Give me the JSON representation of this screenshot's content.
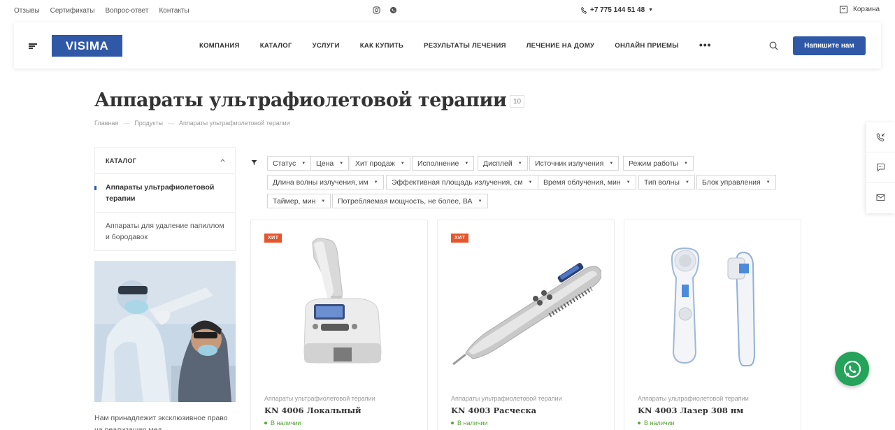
{
  "topbar": {
    "links": [
      "Отзывы",
      "Сертификаты",
      "Вопрос-ответ",
      "Контакты"
    ],
    "phone": "+7 775 144 51 48",
    "cart_label": "Корзина"
  },
  "header": {
    "logo": "VISIMA",
    "nav": [
      "КОМПАНИЯ",
      "КАТАЛОГ",
      "УСЛУГИ",
      "КАК КУПИТЬ",
      "РЕЗУЛЬТАТЫ ЛЕЧЕНИЯ",
      "ЛЕЧЕНИЕ НА ДОМУ",
      "ОНЛАЙН ПРИЕМЫ"
    ],
    "more": "•••",
    "cta": "Напишите нам"
  },
  "page": {
    "title": "Аппараты ультрафиолетовой терапии",
    "count": "10",
    "breadcrumb": [
      "Главная",
      "Продукты",
      "Аппараты ультрафиолетовой терапии"
    ],
    "breadcrumb_sep": "—"
  },
  "sidebar": {
    "catalog_title": "КАТАЛОГ",
    "items": [
      "Аппараты ультрафиолетовой терапии",
      "Аппараты для удаление папиллом и бородавок"
    ],
    "text": "Нам принадлежит эксклюзивное право на реализацию мед"
  },
  "filters": [
    "Статус",
    "Цена",
    "Хит продаж",
    "Исполнение",
    "Дисплей",
    "Источник излучения",
    "Режим работы",
    "Длина волны излучения, им",
    "Эффективная площадь излучения, см",
    "Время облучения, мин",
    "Тип волны",
    "Блок управления",
    "Таймер, мин",
    "Потребляемая мощность, не более, ВА"
  ],
  "products": [
    {
      "badge": "ХИТ",
      "category": "Аппараты ультрафиолетовой терапии",
      "name": "KN 4006 Локальный",
      "stock": "В наличии"
    },
    {
      "badge": "ХИТ",
      "category": "Аппараты ультрафиолетовой терапии",
      "name": "KN 4003 Расческа",
      "stock": "В наличии"
    },
    {
      "badge": "",
      "category": "Аппараты ультрафиолетовой терапии",
      "name": "KN 4003 Лазер 308 нм",
      "stock": "В наличии"
    }
  ],
  "colors": {
    "brand": "#2f58a6",
    "badge": "#e8542c",
    "stock": "#58a53b",
    "whatsapp": "#25a35a"
  }
}
